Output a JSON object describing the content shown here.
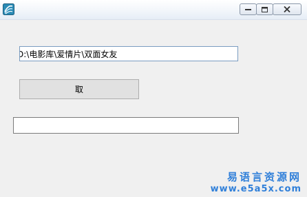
{
  "window": {
    "title": "",
    "icon": "e-language-app-icon",
    "controls": [
      "minimize-icon",
      "maximize-icon",
      "close-icon"
    ]
  },
  "main": {
    "path_field_value": "D:\\电影库\\爱情片\\双面女友",
    "fetch_button_label": "取",
    "result_field_value": ""
  },
  "watermark": {
    "title": "易语言资源网",
    "url": "www.e5a5x.com"
  },
  "colors": {
    "watermark": "#2f7fd9",
    "background": "#f0f0f0"
  }
}
